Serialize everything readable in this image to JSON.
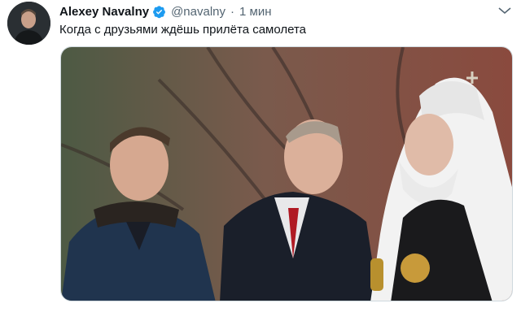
{
  "tweet": {
    "author_name": "Alexey Navalny",
    "handle": "@navalny",
    "separator": "·",
    "time": "1 мин",
    "text": "Когда с друзьями ждёшь прилёта самолета",
    "avatar_icon": "avatar-photo",
    "verified_icon": "verified-badge-icon",
    "more_icon": "more-options-icon"
  },
  "colors": {
    "verified": "#1d9bf0",
    "secondary_text": "#536471",
    "primary_text": "#0f1419"
  }
}
